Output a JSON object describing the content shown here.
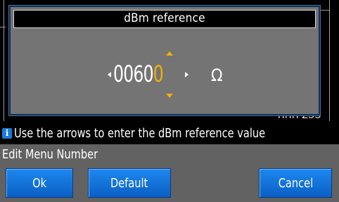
{
  "background": {
    "partial_text": "ППП ZЭЭ"
  },
  "dialog": {
    "title": "dBm reference",
    "digits_before": "0060",
    "digit_active": "0",
    "unit": "Ω"
  },
  "info": {
    "icon": "info-icon",
    "text": "Use the arrows to enter the dBm reference value"
  },
  "menu": {
    "label": "Edit Menu Number"
  },
  "buttons": {
    "ok": "Ok",
    "default": "Default",
    "cancel": "Cancel"
  },
  "colors": {
    "accent": "#f2b100",
    "button": "#1273d9",
    "panel": "#747474"
  }
}
